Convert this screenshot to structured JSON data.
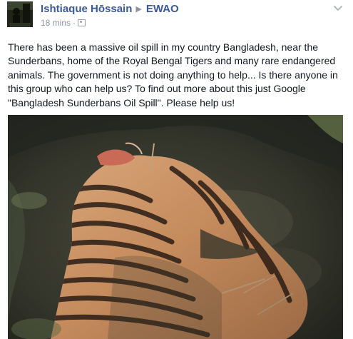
{
  "author": {
    "name": "Ishtiaque Hōssain",
    "avatar": "avatar"
  },
  "group": {
    "name": "EWAO",
    "separator_icon": "right-triangle-icon"
  },
  "meta": {
    "timestamp": "18 mins",
    "separator": "·",
    "audience_icon": "group-audience-icon"
  },
  "menu_icon": "chevron-down-icon",
  "post": {
    "text": "There has been a massive oil spill in my country Bangladesh, near the Sunderbans, home of the Royal Bengal Tigers and many rare endangered animals. The government is not doing anything to help... Is there anyone in this group who can help us? To find out more about this just Google \"Bangladesh Sunderbans Oil Spill\". Please help us!"
  },
  "photo": {
    "subject": "tiger-in-water-photo"
  },
  "colors": {
    "link": "#3b5998",
    "meta": "#90949c",
    "text": "#141823"
  }
}
